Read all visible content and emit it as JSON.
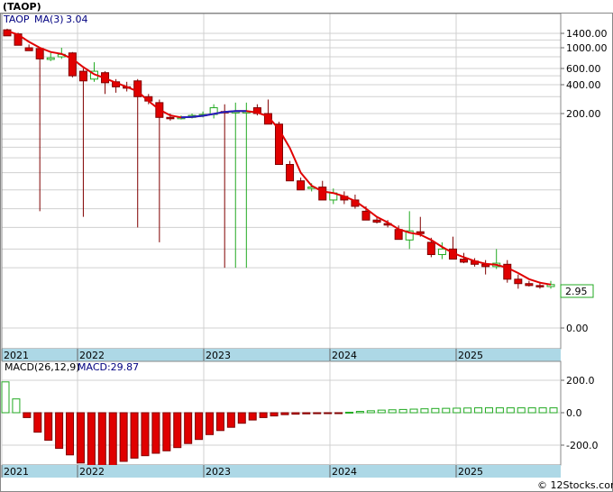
{
  "title": "(TAOP)",
  "legend": {
    "ticker": "TAOP",
    "ma_label": "MA(3)",
    "ma_value": "3.04"
  },
  "last_price_label": "2.95",
  "macd_legend": {
    "label": "MACD(26,12,9)",
    "value_label": "MACD:29.87"
  },
  "watermark": "© 12Stocks.com",
  "colors": {
    "up": "#22aa22",
    "down": "#e00000",
    "ma": "#e00000",
    "ma_flat": "#2020c0",
    "axis_band": "#add8e6",
    "grid": "#bbbbbb",
    "wick": "#800000"
  },
  "chart_data": [
    {
      "type": "candlestick",
      "scale": "log",
      "yticks": [
        "1400.00",
        "1000.00",
        "600.00",
        "400.00",
        "200.00",
        "0.00"
      ],
      "xticks": [
        "2021",
        "2022",
        "2023",
        "2024",
        "2025"
      ],
      "series": [
        {
          "name": "TAOP",
          "ohlc": [
            [
              1520,
              1560,
              1380,
              1320
            ],
            [
              1380,
              1420,
              1100,
              1060
            ],
            [
              1000,
              1080,
              950,
              930
            ],
            [
              980,
              990,
              14,
              760
            ],
            [
              750,
              880,
              720,
              780
            ],
            [
              800,
              1000,
              760,
              850
            ],
            [
              880,
              900,
              480,
              500
            ],
            [
              560,
              600,
              12,
              440
            ],
            [
              460,
              700,
              430,
              560
            ],
            [
              540,
              560,
              320,
              420
            ],
            [
              430,
              460,
              330,
              380
            ],
            [
              380,
              430,
              340,
              370
            ],
            [
              440,
              460,
              9,
              300
            ],
            [
              300,
              320,
              250,
              270
            ],
            [
              260,
              280,
              6,
              180
            ],
            [
              180,
              200,
              165,
              175
            ],
            [
              175,
              190,
              170,
              180
            ],
            [
              180,
              200,
              175,
              190
            ],
            [
              190,
              210,
              180,
              195
            ],
            [
              195,
              250,
              175,
              230
            ],
            [
              210,
              250,
              3,
              205
            ],
            [
              205,
              260,
              3,
              210
            ],
            [
              205,
              260,
              3,
              210
            ],
            [
              230,
              250,
              190,
              200
            ],
            [
              200,
              280,
              180,
              150
            ],
            [
              150,
              160,
              60,
              50
            ],
            [
              50,
              55,
              38,
              32
            ],
            [
              32,
              35,
              26,
              25
            ],
            [
              26,
              30,
              24,
              27
            ],
            [
              27,
              32,
              20,
              19
            ],
            [
              19,
              26,
              17,
              23
            ],
            [
              21,
              24,
              17,
              19
            ],
            [
              19,
              22,
              15,
              16
            ],
            [
              14,
              16,
              12,
              11
            ],
            [
              11,
              12,
              10,
              10.4
            ],
            [
              10,
              11,
              9,
              9.6
            ],
            [
              8.5,
              9.5,
              6.5,
              6.5
            ],
            [
              6.4,
              14,
              5,
              8.2
            ],
            [
              8,
              12,
              7,
              7.6
            ],
            [
              6,
              6.8,
              4,
              4.3
            ],
            [
              4.3,
              6,
              3.8,
              5
            ],
            [
              5,
              7,
              4.5,
              3.8
            ],
            [
              3.8,
              4.5,
              3.4,
              3.5
            ],
            [
              3.6,
              3.9,
              3.1,
              3.3
            ],
            [
              3.3,
              3.7,
              2.5,
              3.1
            ],
            [
              3.1,
              5,
              2.9,
              3.4
            ],
            [
              3.3,
              3.7,
              2,
              2.2
            ],
            [
              2.2,
              2.5,
              1.7,
              1.95
            ],
            [
              1.95,
              2.1,
              1.8,
              1.85
            ],
            [
              1.85,
              2.05,
              1.7,
              1.82
            ],
            [
              1.8,
              2.1,
              1.7,
              1.9
            ]
          ]
        },
        {
          "name": "MA(3)",
          "values": [
            1480,
            1360,
            1150,
            1000,
            900,
            860,
            760,
            620,
            520,
            470,
            420,
            380,
            340,
            270,
            220,
            190,
            180,
            182,
            188,
            198,
            208,
            212,
            212,
            205,
            185,
            130,
            78,
            40,
            28,
            24,
            23,
            21,
            18.5,
            15,
            12,
            10.3,
            8.6,
            7.8,
            7.4,
            6.4,
            5.3,
            4.5,
            4.0,
            3.6,
            3.35,
            3.25,
            3.0,
            2.6,
            2.2,
            2.0,
            1.9
          ]
        }
      ]
    },
    {
      "type": "bar",
      "yticks": [
        "200.0",
        "0.0",
        "-200.0"
      ],
      "xticks": [
        "2021",
        "2022",
        "2023",
        "2024",
        "2025"
      ],
      "series": [
        {
          "name": "MACD(26,12,9)",
          "values": [
            190,
            85,
            -30,
            -120,
            -170,
            -220,
            -260,
            -310,
            -330,
            -335,
            -330,
            -300,
            -280,
            -265,
            -250,
            -235,
            -215,
            -190,
            -165,
            -135,
            -110,
            -90,
            -65,
            -45,
            -30,
            -20,
            -12,
            -9,
            -7,
            -6,
            -5,
            -4,
            3,
            8,
            12,
            16,
            18,
            20,
            22,
            24,
            26,
            27,
            28,
            29,
            30,
            30,
            30,
            30,
            30,
            30,
            30,
            30
          ]
        }
      ]
    }
  ]
}
